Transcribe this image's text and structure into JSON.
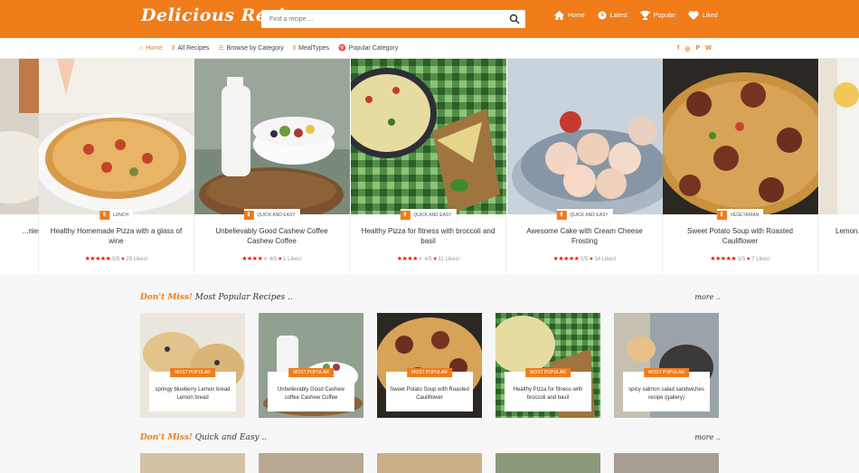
{
  "header": {
    "logo": "Delicious Recipes",
    "search_placeholder": "Find a recipe ...",
    "nav": [
      {
        "label": "Home",
        "icon": "home-icon"
      },
      {
        "label": "Latest",
        "icon": "clock-icon"
      },
      {
        "label": "Popular",
        "icon": "trophy-icon"
      },
      {
        "label": "Liked",
        "icon": "heart-icon"
      }
    ]
  },
  "menu": [
    {
      "label": "Home",
      "icon": "home-icon"
    },
    {
      "label": "All Recipes",
      "icon": "utensils-icon"
    },
    {
      "label": "Browse by Category",
      "icon": "list-icon"
    },
    {
      "label": "MealTypes",
      "icon": "utensils-icon"
    },
    {
      "label": "Popular Category",
      "icon": "trophy-icon"
    }
  ],
  "social": [
    "f",
    "◎",
    "P",
    "W"
  ],
  "slides": [
    {
      "title": "...nies",
      "category": "",
      "rating": 0,
      "likes": ""
    },
    {
      "title": "Healthy Homemade Pizza with a glass of wine",
      "category": "LUNCH",
      "rating": 5,
      "rating_text": "5/5",
      "likes": "29 Likes!"
    },
    {
      "title": "Unbelievably Good Cashew Coffee Cashew Coffee",
      "category": "QUICK AND EASY",
      "rating": 4,
      "rating_text": "4/5",
      "likes": "1 Likes!"
    },
    {
      "title": "Healthy Pizza for fitness with broccoli and basil",
      "category": "QUICK AND EASY",
      "rating": 4,
      "rating_text": "4/5",
      "likes": "11 Likes!"
    },
    {
      "title": "Awesome Cake with Cream Cheese Frosting",
      "category": "QUICK AND EASY",
      "rating": 5,
      "rating_text": "5/5",
      "likes": "34 Likes!"
    },
    {
      "title": "Sweet Potato Soup with Roasted Cauliflower",
      "category": "VEGETARIAN",
      "rating": 5,
      "rating_text": "5/5",
      "likes": "7 Likes!"
    },
    {
      "title": "Lemon...",
      "category": "",
      "rating": 0,
      "likes": ""
    }
  ],
  "popular": {
    "accent": "Don't Miss!",
    "title": "Most Popular Recipes ..",
    "more": "more ..",
    "badge": "MOST POPULAR",
    "cards": [
      "springy blueberry Lemon bread Lemon bread",
      "Unbelievably Good Cashew coffee Cashew Coffee",
      "Sweet Potato Soup with Roasted Cauliflower",
      "Healthy Pizza for fitness with broccoli and basil",
      "spicy salmon salad sandwiches recipe (gallery)"
    ]
  },
  "quick": {
    "accent": "Don't Miss!",
    "title": "Quick and Easy ..",
    "more": "more .."
  },
  "colors": {
    "accent": "#f07c1a",
    "star": "#e41b17"
  }
}
